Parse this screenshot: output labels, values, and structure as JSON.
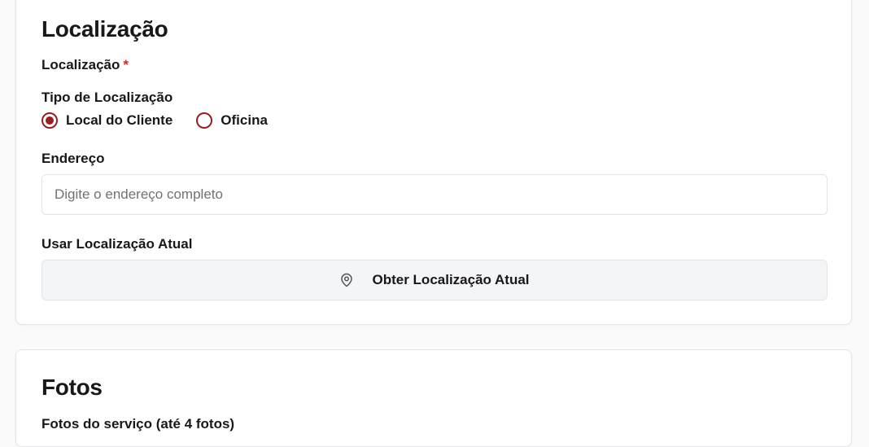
{
  "location_section": {
    "title": "Localização",
    "location_label": "Localização",
    "required_mark": "*",
    "type_label": "Tipo de Localização",
    "type_options": [
      {
        "label": "Local do Cliente",
        "selected": true
      },
      {
        "label": "Oficina",
        "selected": false
      }
    ],
    "address_label": "Endereço",
    "address_placeholder": "Digite o endereço completo",
    "address_value": "",
    "current_location_label": "Usar Localização Atual",
    "current_location_button": "Obter Localização Atual",
    "current_location_icon": "map-pin-icon"
  },
  "photos_section": {
    "title": "Fotos",
    "photos_label": "Fotos do serviço (até 4 fotos)"
  },
  "colors": {
    "accent": "#9b1c1c",
    "required": "#dc2626",
    "border": "#e4e4e7",
    "button_bg": "#f4f5f7"
  }
}
